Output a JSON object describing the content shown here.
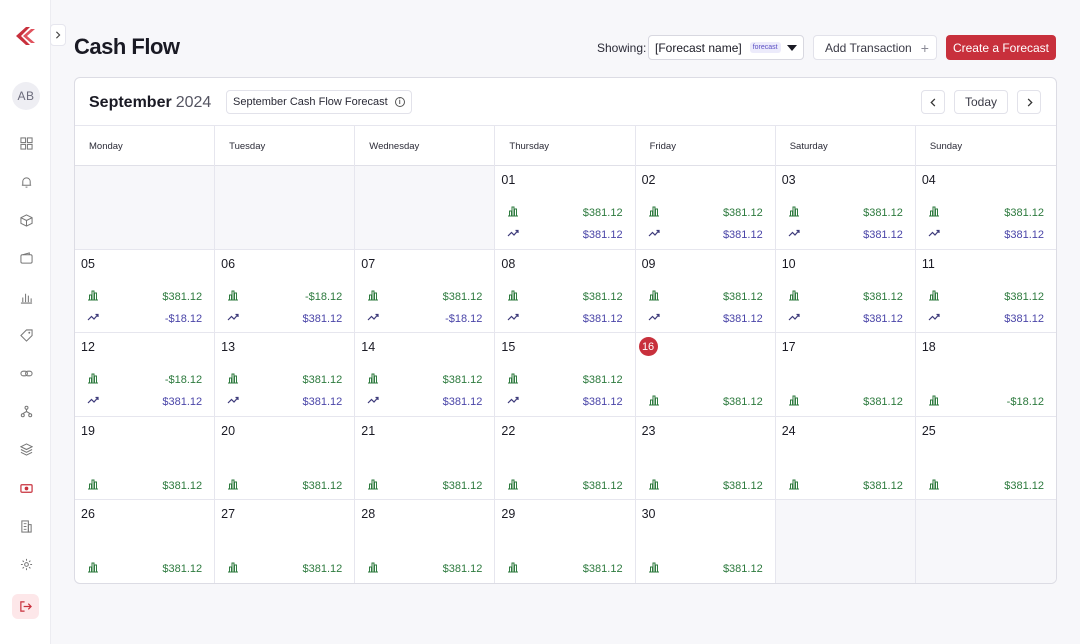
{
  "app": {
    "title": "Cash Flow",
    "user_initials": "AB",
    "accent_color": "#c8303c"
  },
  "sidebar": {
    "items": [
      {
        "icon": "grid-icon"
      },
      {
        "icon": "bell-icon"
      },
      {
        "icon": "box-icon"
      },
      {
        "icon": "wallet-icon"
      },
      {
        "icon": "chart-icon"
      },
      {
        "icon": "tag-icon"
      },
      {
        "icon": "link-icon"
      },
      {
        "icon": "network-icon"
      },
      {
        "icon": "layers-icon"
      },
      {
        "icon": "cash-icon"
      },
      {
        "icon": "building-icon"
      },
      {
        "icon": "gear-icon"
      }
    ],
    "logout_icon": "logout-icon"
  },
  "toolbar": {
    "showing_label": "Showing:",
    "forecast_name": "[Forecast name]",
    "forecast_tag": "forecast",
    "add_transaction": "Add Transaction",
    "create_forecast": "Create a Forecast"
  },
  "calendar": {
    "month": "September",
    "year": "2024",
    "forecast_title": "September Cash Flow Forecast",
    "today_label": "Today",
    "weekdays": [
      "Monday",
      "Tuesday",
      "Wednesday",
      "Thursday",
      "Friday",
      "Saturday",
      "Sunday"
    ],
    "weeks": [
      [
        null,
        null,
        null,
        {
          "day": "01",
          "bar": "$381.12",
          "trend": "$381.12"
        },
        {
          "day": "02",
          "bar": "$381.12",
          "trend": "$381.12"
        },
        {
          "day": "03",
          "bar": "$381.12",
          "trend": "$381.12"
        },
        {
          "day": "04",
          "bar": "$381.12",
          "trend": "$381.12"
        }
      ],
      [
        {
          "day": "05",
          "bar": "$381.12",
          "trend": "-$18.12"
        },
        {
          "day": "06",
          "bar": "-$18.12",
          "trend": "$381.12"
        },
        {
          "day": "07",
          "bar": "$381.12",
          "trend": "-$18.12"
        },
        {
          "day": "08",
          "bar": "$381.12",
          "trend": "$381.12"
        },
        {
          "day": "09",
          "bar": "$381.12",
          "trend": "$381.12"
        },
        {
          "day": "10",
          "bar": "$381.12",
          "trend": "$381.12"
        },
        {
          "day": "11",
          "bar": "$381.12",
          "trend": "$381.12"
        }
      ],
      [
        {
          "day": "12",
          "bar": "-$18.12",
          "trend": "$381.12"
        },
        {
          "day": "13",
          "bar": "$381.12",
          "trend": "$381.12"
        },
        {
          "day": "14",
          "bar": "$381.12",
          "trend": "$381.12"
        },
        {
          "day": "15",
          "bar": "$381.12",
          "trend": "$381.12"
        },
        {
          "day": "16",
          "today": true,
          "bar": "$381.12"
        },
        {
          "day": "17",
          "bar": "$381.12"
        },
        {
          "day": "18",
          "bar": "-$18.12"
        }
      ],
      [
        {
          "day": "19",
          "bar": "$381.12"
        },
        {
          "day": "20",
          "bar": "$381.12"
        },
        {
          "day": "21",
          "bar": "$381.12"
        },
        {
          "day": "22",
          "bar": "$381.12"
        },
        {
          "day": "23",
          "bar": "$381.12"
        },
        {
          "day": "24",
          "bar": "$381.12"
        },
        {
          "day": "25",
          "bar": "$381.12"
        }
      ],
      [
        {
          "day": "26",
          "bar": "$381.12"
        },
        {
          "day": "27",
          "bar": "$381.12"
        },
        {
          "day": "28",
          "bar": "$381.12"
        },
        {
          "day": "29",
          "bar": "$381.12"
        },
        {
          "day": "30",
          "bar": "$381.12"
        },
        null,
        null
      ]
    ]
  }
}
